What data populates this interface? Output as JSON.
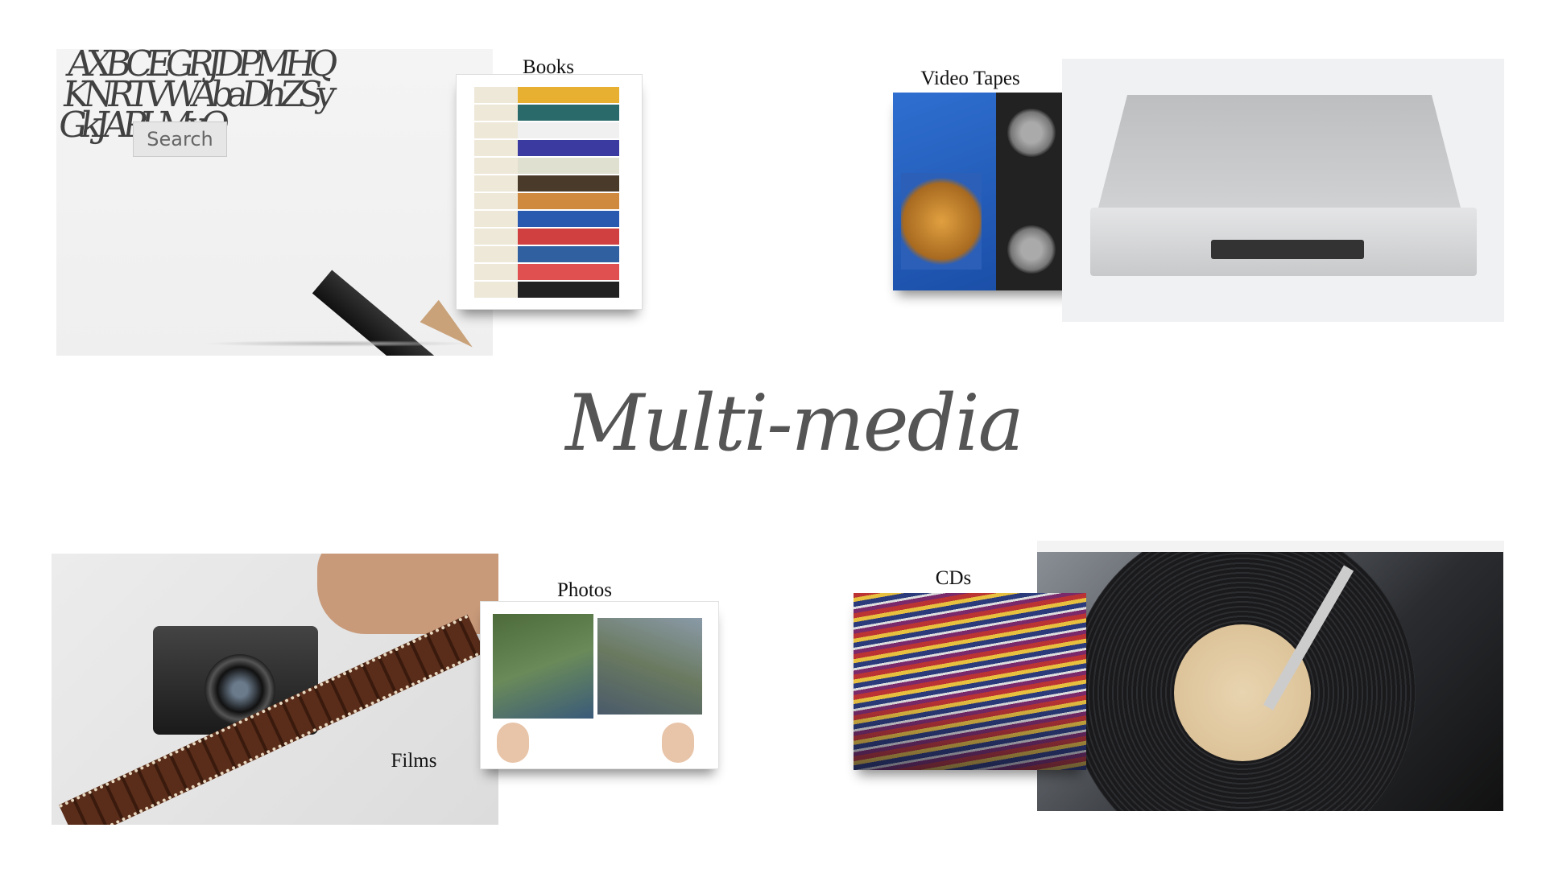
{
  "title": "Multi-media",
  "labels": {
    "books": "Books",
    "video_tapes": "Video Tapes",
    "photos": "Photos",
    "films": "Films",
    "cds": "CDs"
  },
  "images": {
    "pencil": {
      "search_text": "Search",
      "letters": "AXBCEGRJDPMHQKNRTVWAbaDhZSyGkJAPLMxQ"
    },
    "books_spines": [
      "#e8b030",
      "#2a6a6a",
      "#f0f0f0",
      "#3a3aa0",
      "#e0e0d0",
      "#4a3a2a",
      "#d08a40",
      "#2a5ab0",
      "#d04040",
      "#3060a0",
      "#e05050",
      "#222"
    ]
  }
}
